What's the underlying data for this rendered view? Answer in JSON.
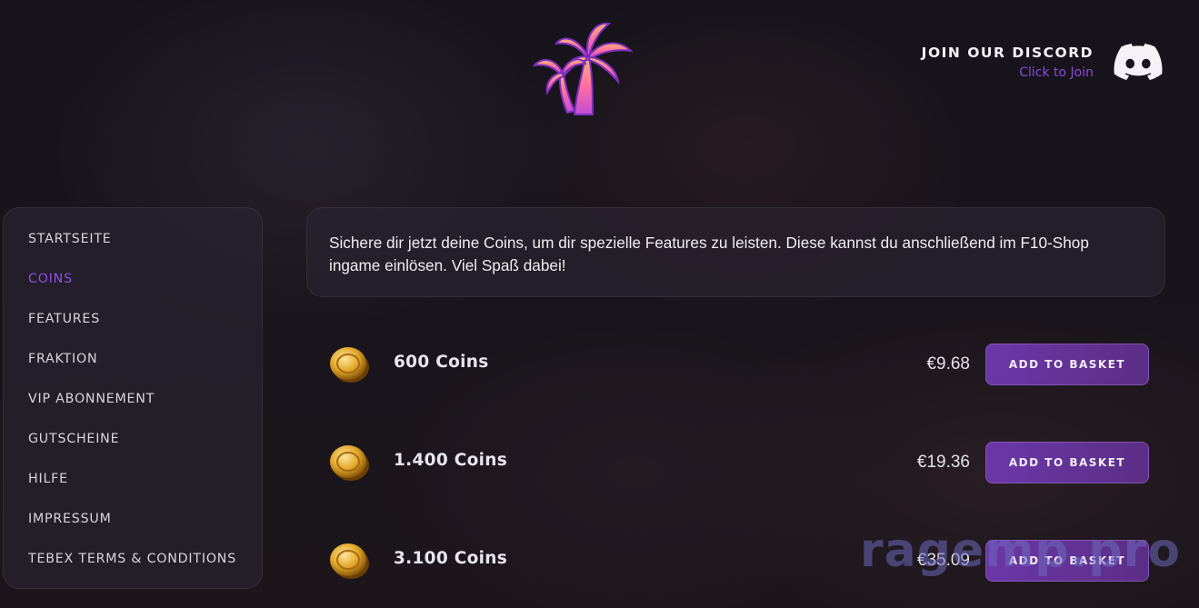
{
  "header": {
    "logo": "palm-trees-logo",
    "discord": {
      "title": "JOIN OUR DISCORD",
      "subtitle": "Click to Join",
      "icon": "discord-icon"
    }
  },
  "sidebar": {
    "items": [
      {
        "label": "STARTSEITE",
        "active": false
      },
      {
        "label": "COINS",
        "active": true
      },
      {
        "label": "FEATURES",
        "active": false
      },
      {
        "label": "FRAKTION",
        "active": false
      },
      {
        "label": "VIP ABONNEMENT",
        "active": false
      },
      {
        "label": "GUTSCHEINE",
        "active": false
      },
      {
        "label": "HILFE",
        "active": false
      },
      {
        "label": "IMPRESSUM",
        "active": false
      },
      {
        "label": "TEBEX TERMS & CONDITIONS",
        "active": false
      }
    ]
  },
  "intro": {
    "text": "Sichere dir jetzt deine Coins, um dir spezielle Features zu leisten. Diese kannst du anschließend im F10-Shop ingame einlösen. Viel Spaß dabei!"
  },
  "products": [
    {
      "name": "600 Coins",
      "price": "€9.68",
      "button": "ADD TO BASKET",
      "icon": "gold-coin-icon"
    },
    {
      "name": "1.400 Coins",
      "price": "€19.36",
      "button": "ADD TO BASKET",
      "icon": "gold-coin-icon"
    },
    {
      "name": "3.100 Coins",
      "price": "€35.09",
      "button": "ADD TO BASKET",
      "icon": "gold-coin-icon"
    }
  ],
  "watermark": "ragemp.pro",
  "colors": {
    "accent": "#8f4ee0",
    "button": "#6b37a8",
    "background": "#1e1a22"
  }
}
